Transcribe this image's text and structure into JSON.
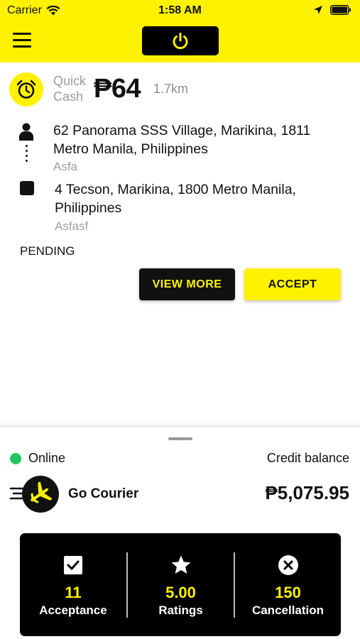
{
  "status_bar": {
    "carrier": "Carrier",
    "time": "1:58 AM"
  },
  "trip": {
    "payment_type": "Quick Cash",
    "fare": "₱64",
    "distance": "1.7km",
    "pickup": {
      "address": "62 Panorama SSS Village, Marikina, 1811 Metro Manila, Philippines",
      "note": "Asfa"
    },
    "dropoff": {
      "address": "4 Tecson, Marikina, 1800 Metro Manila, Philippines",
      "note": "Asfasf"
    },
    "status": "PENDING",
    "view_more_label": "VIEW MORE",
    "accept_label": "ACCEPT"
  },
  "driver": {
    "online_label": "Online",
    "credit_label": "Credit balance",
    "service_name": "Go Courier",
    "balance": "₱5,075.95"
  },
  "stats": [
    {
      "icon": "checkbox-icon",
      "value": "11",
      "label": "Acceptance"
    },
    {
      "icon": "star-icon",
      "value": "5.00",
      "label": "Ratings"
    },
    {
      "icon": "cancel-circle-icon",
      "value": "150",
      "label": "Cancellation"
    }
  ],
  "colors": {
    "brand_yellow": "#FFF200",
    "online_green": "#22C55E",
    "dark": "#000000"
  }
}
